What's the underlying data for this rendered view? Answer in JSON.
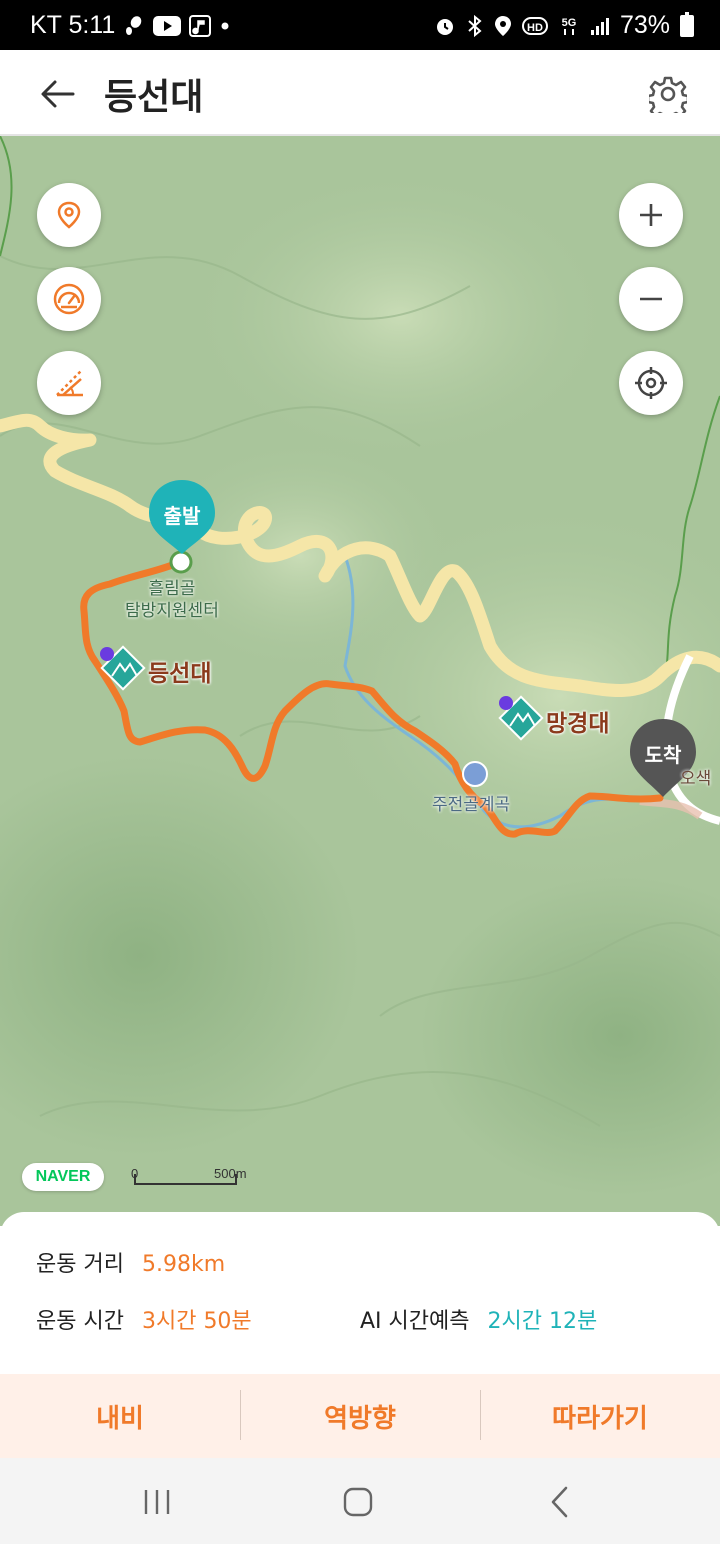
{
  "status_bar": {
    "carrier_time": "KT 5:11",
    "battery": "73%",
    "icons_left": [
      "footprint-icon",
      "youtube-icon",
      "music-note-icon",
      "dot-icon"
    ],
    "icons_right": [
      "alarm-icon",
      "bluetooth-icon",
      "location-icon",
      "hd-icon",
      "5g-icon",
      "signal-icon",
      "battery-icon"
    ],
    "network_hd": "HD",
    "network_5g": "5G"
  },
  "header": {
    "title": "등선대",
    "back_icon": "arrow-left-icon",
    "settings_icon": "gear-icon"
  },
  "map": {
    "left_controls": [
      "location-pin-icon",
      "speedometer-icon",
      "slope-icon"
    ],
    "right_controls": [
      "plus-icon",
      "minus-icon",
      "crosshair-icon"
    ],
    "start_pin": "출발",
    "end_pin": "도착",
    "start_place": "흘림골\n탐방지원센터",
    "start_place_line1": "흘림골",
    "start_place_line2": "탐방지원센터",
    "peak_1": "등선대",
    "peak_2": "망경대",
    "valley": "주전골계곡",
    "edge_label": "오색",
    "naver": "NAVER",
    "scale_zero": "0",
    "scale_max": "500m",
    "route_color": "#f07a2a",
    "pin_start_color": "#1fb3b8",
    "pin_end_color": "#555555"
  },
  "info": {
    "distance_label": "운동 거리",
    "distance_value": "5.98km",
    "time_label": "운동 시간",
    "time_value": "3시간 50분",
    "ai_label": "AI 시간예측",
    "ai_value": "2시간 12분"
  },
  "actions": {
    "navigate": "내비",
    "reverse": "역방향",
    "follow": "따라가기"
  },
  "nav_bar": {
    "recent_icon": "recent-apps-icon",
    "home_icon": "home-icon",
    "back_icon": "back-chevron-icon"
  }
}
